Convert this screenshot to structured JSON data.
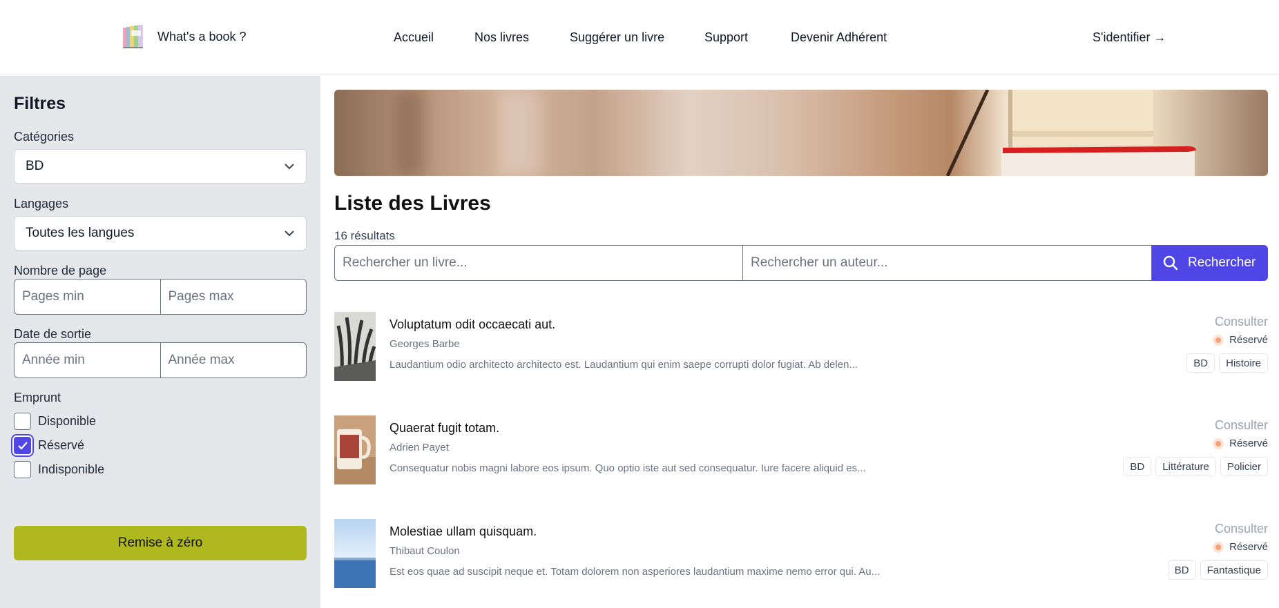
{
  "header": {
    "brand": "What's a book ?",
    "nav": [
      "Accueil",
      "Nos livres",
      "Suggérer un livre",
      "Support",
      "Devenir Adhérent"
    ],
    "login": "S'identifier →"
  },
  "filters": {
    "title": "Filtres",
    "categories": {
      "label": "Catégories",
      "selected": "BD"
    },
    "languages": {
      "label": "Langages",
      "selected": "Toutes les langues"
    },
    "pages": {
      "label": "Nombre de page",
      "min_placeholder": "Pages min",
      "max_placeholder": "Pages max"
    },
    "release": {
      "label": "Date de sortie",
      "min_placeholder": "Année min",
      "max_placeholder": "Année max"
    },
    "loan": {
      "label": "Emprunt",
      "options": [
        {
          "label": "Disponible",
          "checked": false
        },
        {
          "label": "Réservé",
          "checked": true
        },
        {
          "label": "Indisponible",
          "checked": false
        }
      ]
    },
    "reset": "Remise à zéro"
  },
  "main": {
    "title": "Liste des Livres",
    "count": "16 résultats",
    "search": {
      "book_placeholder": "Rechercher un livre...",
      "author_placeholder": "Rechercher un auteur...",
      "button": "Rechercher"
    },
    "books": [
      {
        "title": "Voluptatum odit occaecati aut.",
        "author": "Georges Barbe",
        "description": "Laudantium odio architecto architecto est. Laudantium qui enim saepe corrupti dolor fugiat. Ab delen...",
        "action": "Consulter",
        "status": "Réservé",
        "tags": [
          "BD",
          "Histoire"
        ]
      },
      {
        "title": "Quaerat fugit totam.",
        "author": "Adrien Payet",
        "description": "Consequatur nobis magni labore eos ipsum. Quo optio iste aut sed consequatur. Iure facere aliquid es...",
        "action": "Consulter",
        "status": "Réservé",
        "tags": [
          "BD",
          "Littérature",
          "Policier"
        ]
      },
      {
        "title": "Molestiae ullam quisquam.",
        "author": "Thibaut Coulon",
        "description": "Est eos quae ad suscipit neque et. Totam dolorem non asperiores laudantium maxime nemo error qui. Au...",
        "action": "Consulter",
        "status": "Réservé",
        "tags": [
          "BD",
          "Fantastique"
        ]
      }
    ]
  },
  "colors": {
    "accent": "#4f46e5",
    "reset_button": "#b0b81f",
    "sidebar_bg": "#e5e7eb",
    "status_dot": "#f6a17a"
  }
}
